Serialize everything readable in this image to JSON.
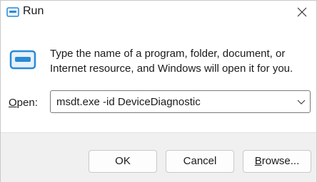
{
  "window": {
    "title": "Run"
  },
  "description": "Type the name of a program, folder, document, or Internet resource, and Windows will open it for you.",
  "open_field": {
    "label_mnemonic": "O",
    "label_rest": "pen:",
    "value": "msdt.exe -id DeviceDiagnostic"
  },
  "buttons": {
    "ok": "OK",
    "cancel": "Cancel",
    "browse_mnemonic": "B",
    "browse_rest": "rowse..."
  },
  "icons": {
    "app": "run-icon",
    "close": "close-icon",
    "dropdown": "chevron-down-icon"
  },
  "colors": {
    "accent": "#2a8ad4",
    "footer_bg": "#f0f0f0"
  }
}
